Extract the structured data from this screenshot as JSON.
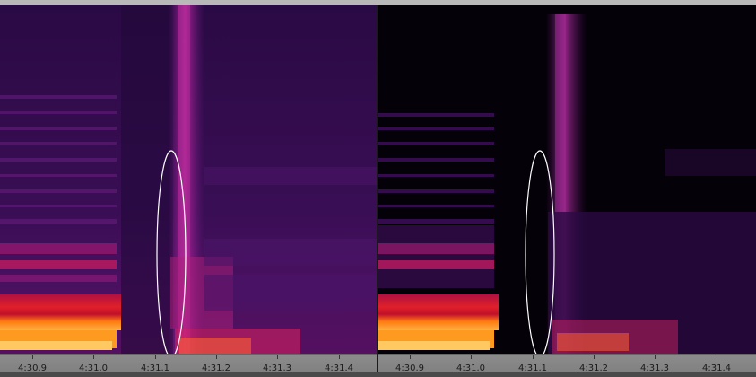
{
  "app": {
    "colors": {
      "background_left": "#2e0b47",
      "background_right": "#050108",
      "hot": "#ff5a00",
      "mid": "#c0145a",
      "line": "#7a1d8c",
      "marker": "#ffffff"
    }
  },
  "panels": [
    {
      "id": "original",
      "timeline": [
        "4:30.9",
        "4:31.0",
        "4:31.1",
        "4:31.2",
        "4:31.3",
        "4:31.4"
      ]
    },
    {
      "id": "processed",
      "timeline": [
        "4:30.9",
        "4:31.0",
        "4:31.1",
        "4:31.2",
        "4:31.3",
        "4:31.4"
      ]
    }
  ]
}
